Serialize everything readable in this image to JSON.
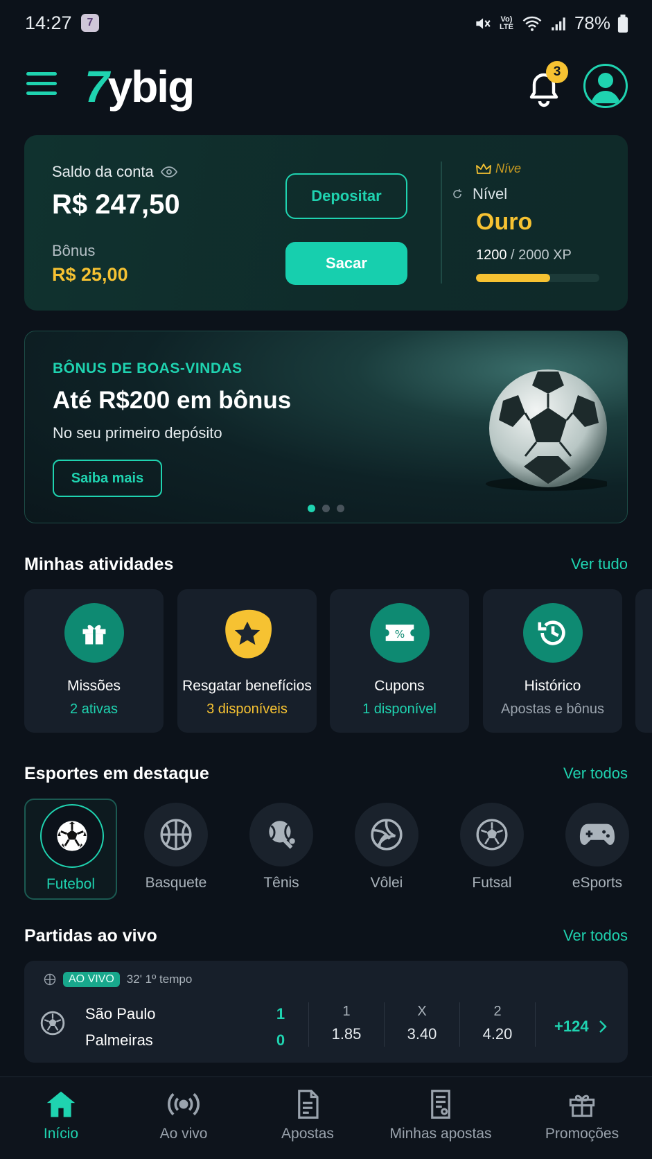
{
  "status_bar": {
    "time": "14:27",
    "app_icon": "7",
    "battery": "78%",
    "lte": "Vo) LTE"
  },
  "header": {
    "logo_number": "7",
    "logo_text": "ybig",
    "notification_count": "3"
  },
  "balance": {
    "label": "Saldo da conta",
    "value": "R$ 247,50",
    "bonus_label": "Bônus",
    "bonus_value": "R$ 25,00",
    "deposit_label": "Depositar",
    "withdraw_label": "Sacar",
    "level_crown_text": "Níve",
    "level_label": "Nível",
    "level_value": "Ouro",
    "xp_current": "1200",
    "xp_max": " / 2000 XP",
    "xp_fraction": 0.6
  },
  "banner": {
    "kicker": "BÔNUS DE BOAS-VINDAS",
    "title": "Até R$200 em bônus",
    "subtitle": "No seu primeiro depósito",
    "button": "Saiba mais",
    "active_dot": 0
  },
  "activities": {
    "title": "Minhas atividades",
    "link": "Ver tudo",
    "items": [
      {
        "title": "Missões",
        "sub": "2 ativas",
        "icon": "gift-icon"
      },
      {
        "title": "Resgatar benefícios",
        "sub": "3 disponíveis",
        "icon": "star-icon"
      },
      {
        "title": "Cupons",
        "sub": "1 disponível",
        "icon": "coupon-icon"
      },
      {
        "title": "Histórico",
        "sub": "Apostas e bônus",
        "icon": "history-icon"
      }
    ]
  },
  "sports": {
    "title": "Esportes em destaque",
    "link": "Ver todos",
    "items": [
      {
        "label": "Futebol",
        "icon": "soccer-ball-icon"
      },
      {
        "label": "Basquete",
        "icon": "basketball-icon"
      },
      {
        "label": "Tênis",
        "icon": "tennis-icon"
      },
      {
        "label": "Vôlei",
        "icon": "volleyball-icon"
      },
      {
        "label": "Futsal",
        "icon": "futsal-ball-icon"
      },
      {
        "label": "eSports",
        "icon": "gamepad-icon"
      }
    ]
  },
  "live": {
    "title": "Partidas ao vivo",
    "link": "Ver todos",
    "match": {
      "badge": "AO VIVO",
      "time": "32' 1º tempo",
      "home": "São Paulo",
      "away": "Palmeiras",
      "home_score": "1",
      "away_score": "0",
      "odds": [
        {
          "label": "1",
          "value": "1.85"
        },
        {
          "label": "X",
          "value": "3.40"
        },
        {
          "label": "2",
          "value": "4.20"
        }
      ],
      "more": "+124"
    }
  },
  "nav": {
    "items": [
      {
        "label": "Início",
        "icon": "home-icon"
      },
      {
        "label": "Ao vivo",
        "icon": "live-broadcast-icon"
      },
      {
        "label": "Apostas",
        "icon": "bets-document-icon"
      },
      {
        "label": "Minhas apostas",
        "icon": "my-bets-icon"
      },
      {
        "label": "Promoções",
        "icon": "gift-icon"
      }
    ]
  },
  "colors": {
    "accent": "#1fd3b0",
    "gold": "#f6c232",
    "background": "#0c121a",
    "card": "#171f2a"
  }
}
